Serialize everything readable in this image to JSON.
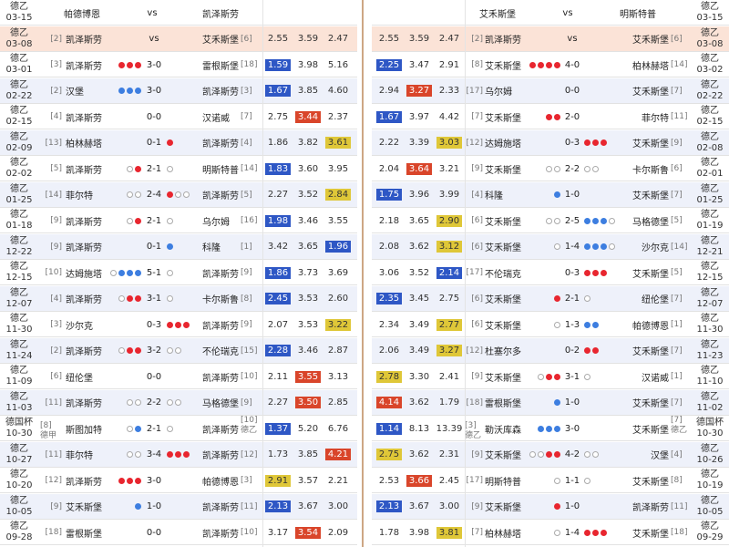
{
  "left": {
    "header": {
      "league": "德乙",
      "date": "03-15",
      "home": "帕德博恩",
      "vs": "vs",
      "away": "凯泽斯劳"
    },
    "current": {
      "league": "德乙",
      "date": "03-08",
      "home_rank": "[2]",
      "home": "凯泽斯劳",
      "vs": "vs",
      "away": "艾禾斯堡",
      "away_rank": "[6]",
      "o1": "2.55",
      "o2": "3.59",
      "o3": "2.47"
    },
    "rows": [
      {
        "league": "德乙",
        "date": "03-01",
        "home_rank": "[3]",
        "home": "凯泽斯劳",
        "dots_l": "rrr",
        "score": "3-0",
        "dots_r": "",
        "away": "雷根斯堡",
        "away_rank": "[18]",
        "o1": "1.59",
        "o2": "3.98",
        "o3": "5.16",
        "hl": "1b"
      },
      {
        "league": "德乙",
        "date": "02-22",
        "home_rank": "[2]",
        "home": "汉堡",
        "dots_l": "bbb",
        "score": "3-0",
        "dots_r": "",
        "away": "凯泽斯劳",
        "away_rank": "[3]",
        "o1": "1.67",
        "o2": "3.85",
        "o3": "4.60",
        "hl": "1b"
      },
      {
        "league": "德乙",
        "date": "02-15",
        "home_rank": "[4]",
        "home": "凯泽斯劳",
        "dots_l": "",
        "score": "0-0",
        "dots_r": "",
        "away": "汉诺威",
        "away_rank": "[7]",
        "o1": "2.75",
        "o2": "3.44",
        "o3": "2.37",
        "hl": "2r"
      },
      {
        "league": "德乙",
        "date": "02-09",
        "home_rank": "[13]",
        "home": "柏林赫塔",
        "dots_l": "",
        "score": "0-1",
        "dots_r": "r",
        "away": "凯泽斯劳",
        "away_rank": "[4]",
        "o1": "1.86",
        "o2": "3.82",
        "o3": "3.61",
        "hl": "3y"
      },
      {
        "league": "德乙",
        "date": "02-02",
        "home_rank": "[5]",
        "home": "凯泽斯劳",
        "dots_l": "or",
        "score": "2-1",
        "dots_r": "o",
        "away": "明斯特普",
        "away_rank": "[14]",
        "o1": "1.83",
        "o2": "3.60",
        "o3": "3.95",
        "hl": "1b"
      },
      {
        "league": "德乙",
        "date": "01-25",
        "home_rank": "[14]",
        "home": "菲尔特",
        "dots_l": "oo",
        "score": "2-4",
        "dots_r": "roo",
        "away": "凯泽斯劳",
        "away_rank": "[5]",
        "o1": "2.27",
        "o2": "3.52",
        "o3": "2.84",
        "hl": "3y"
      },
      {
        "league": "德乙",
        "date": "01-18",
        "home_rank": "[9]",
        "home": "凯泽斯劳",
        "dots_l": "or",
        "score": "2-1",
        "dots_r": "o",
        "away": "乌尔姆",
        "away_rank": "[16]",
        "o1": "1.98",
        "o2": "3.46",
        "o3": "3.55",
        "hl": "1b"
      },
      {
        "league": "德乙",
        "date": "12-22",
        "home_rank": "[9]",
        "home": "凯泽斯劳",
        "dots_l": "",
        "score": "0-1",
        "dots_r": "b",
        "away": "科隆",
        "away_rank": "[1]",
        "o1": "3.42",
        "o2": "3.65",
        "o3": "1.96",
        "hl": "3b"
      },
      {
        "league": "德乙",
        "date": "12-15",
        "home_rank": "[10]",
        "home": "达姆施塔",
        "dots_l": "obbb",
        "score": "5-1",
        "dots_r": "o",
        "away": "凯泽斯劳",
        "away_rank": "[9]",
        "o1": "1.86",
        "o2": "3.73",
        "o3": "3.69",
        "hl": "1b"
      },
      {
        "league": "德乙",
        "date": "12-07",
        "home_rank": "[4]",
        "home": "凯泽斯劳",
        "dots_l": "orr",
        "score": "3-1",
        "dots_r": "o",
        "away": "卡尔斯鲁",
        "away_rank": "[8]",
        "o1": "2.45",
        "o2": "3.53",
        "o3": "2.60",
        "hl": "1b"
      },
      {
        "league": "德乙",
        "date": "11-30",
        "home_rank": "[3]",
        "home": "沙尔克",
        "dots_l": "",
        "score": "0-3",
        "dots_r": "rrr",
        "away": "凯泽斯劳",
        "away_rank": "[9]",
        "o1": "2.07",
        "o2": "3.53",
        "o3": "3.22",
        "hl": "3y"
      },
      {
        "league": "德乙",
        "date": "11-24",
        "home_rank": "[2]",
        "home": "凯泽斯劳",
        "dots_l": "orr",
        "score": "3-2",
        "dots_r": "oo",
        "away": "不伦瑞克",
        "away_rank": "[15]",
        "o1": "2.28",
        "o2": "3.46",
        "o3": "2.87",
        "hl": "1b"
      },
      {
        "league": "德乙",
        "date": "11-09",
        "home_rank": "[6]",
        "home": "纽伦堡",
        "dots_l": "",
        "score": "0-0",
        "dots_r": "",
        "away": "凯泽斯劳",
        "away_rank": "[10]",
        "o1": "2.11",
        "o2": "3.55",
        "o3": "3.13",
        "hl": "2r"
      },
      {
        "league": "德乙",
        "date": "11-03",
        "home_rank": "[11]",
        "home": "凯泽斯劳",
        "dots_l": "oo",
        "score": "2-2",
        "dots_r": "oo",
        "away": "马格德堡",
        "away_rank": "[9]",
        "o1": "2.27",
        "o2": "3.50",
        "o3": "2.85",
        "hl": "2r"
      },
      {
        "league": "德国杯",
        "date": "10-30",
        "home_rank": "[8]",
        "home_rank2": "德甲",
        "home": "斯图加特",
        "dots_l": "ob",
        "score": "2-1",
        "dots_r": "o",
        "away": "凯泽斯劳",
        "away_rank": "[10]",
        "away_rank2": "德乙",
        "o1": "1.37",
        "o2": "5.20",
        "o3": "6.76",
        "hl": "1b"
      },
      {
        "league": "德乙",
        "date": "10-27",
        "home_rank": "[11]",
        "home": "菲尔特",
        "dots_l": "oo",
        "score": "3-4",
        "dots_r": "rrr",
        "away": "凯泽斯劳",
        "away_rank": "[12]",
        "o1": "1.73",
        "o2": "3.85",
        "o3": "4.21",
        "hl": "3r"
      },
      {
        "league": "德乙",
        "date": "10-20",
        "home_rank": "[12]",
        "home": "凯泽斯劳",
        "dots_l": "rrr",
        "score": "3-0",
        "dots_r": "",
        "away": "帕德博恩",
        "away_rank": "[3]",
        "o1": "2.91",
        "o2": "3.57",
        "o3": "2.21",
        "hl": "1y"
      },
      {
        "league": "德乙",
        "date": "10-05",
        "home_rank": "[9]",
        "home": "艾禾斯堡",
        "dots_l": "b",
        "score": "1-0",
        "dots_r": "",
        "away": "凯泽斯劳",
        "away_rank": "[11]",
        "o1": "2.13",
        "o2": "3.67",
        "o3": "3.00",
        "hl": "1b"
      },
      {
        "league": "德乙",
        "date": "09-28",
        "home_rank": "[18]",
        "home": "雷根斯堡",
        "dots_l": "",
        "score": "0-0",
        "dots_r": "",
        "away": "凯泽斯劳",
        "away_rank": "[10]",
        "o1": "3.17",
        "o2": "3.54",
        "o3": "2.09",
        "hl": "2r"
      }
    ]
  },
  "right": {
    "header": {
      "home": "艾禾斯堡",
      "vs": "vs",
      "away": "明斯特普",
      "league": "德乙",
      "date": "03-15"
    },
    "current": {
      "o1": "2.55",
      "o2": "3.59",
      "o3": "2.47",
      "home_rank": "[2]",
      "home": "凯泽斯劳",
      "vs": "vs",
      "away": "艾禾斯堡",
      "away_rank": "[6]",
      "league": "德乙",
      "date": "03-08"
    },
    "rows": [
      {
        "o1": "2.25",
        "o2": "3.47",
        "o3": "2.91",
        "hl": "1b",
        "home_rank": "[8]",
        "home": "艾禾斯堡",
        "dots_l": "rrrr",
        "score": "4-0",
        "dots_r": "",
        "away": "柏林赫塔",
        "away_rank": "[14]",
        "league": "德乙",
        "date": "03-02"
      },
      {
        "o1": "2.94",
        "o2": "3.27",
        "o3": "2.33",
        "hl": "2r",
        "home_rank": "[17]",
        "home": "乌尔姆",
        "dots_l": "",
        "score": "0-0",
        "dots_r": "",
        "away": "艾禾斯堡",
        "away_rank": "[7]",
        "league": "德乙",
        "date": "02-22"
      },
      {
        "o1": "1.67",
        "o2": "3.97",
        "o3": "4.42",
        "hl": "1b",
        "home_rank": "[7]",
        "home": "艾禾斯堡",
        "dots_l": "rr",
        "score": "2-0",
        "dots_r": "",
        "away": "菲尔特",
        "away_rank": "[11]",
        "league": "德乙",
        "date": "02-15"
      },
      {
        "o1": "2.22",
        "o2": "3.39",
        "o3": "3.03",
        "hl": "3y",
        "home_rank": "[12]",
        "home": "达姆施塔",
        "dots_l": "",
        "score": "0-3",
        "dots_r": "rrr",
        "away": "艾禾斯堡",
        "away_rank": "[9]",
        "league": "德乙",
        "date": "02-08"
      },
      {
        "o1": "2.04",
        "o2": "3.64",
        "o3": "3.21",
        "hl": "2r",
        "home_rank": "[9]",
        "home": "艾禾斯堡",
        "dots_l": "oo",
        "score": "2-2",
        "dots_r": "oo",
        "away": "卡尔斯鲁",
        "away_rank": "[6]",
        "league": "德乙",
        "date": "02-01"
      },
      {
        "o1": "1.75",
        "o2": "3.96",
        "o3": "3.99",
        "hl": "1b",
        "home_rank": "[4]",
        "home": "科隆",
        "dots_l": "b",
        "score": "1-0",
        "dots_r": "",
        "away": "艾禾斯堡",
        "away_rank": "[7]",
        "league": "德乙",
        "date": "01-25"
      },
      {
        "o1": "2.18",
        "o2": "3.65",
        "o3": "2.90",
        "hl": "3y",
        "home_rank": "[6]",
        "home": "艾禾斯堡",
        "dots_l": "oo",
        "score": "2-5",
        "dots_r": "bbbo",
        "away": "马格德堡",
        "away_rank": "[5]",
        "league": "德乙",
        "date": "01-19"
      },
      {
        "o1": "2.08",
        "o2": "3.62",
        "o3": "3.12",
        "hl": "3y",
        "home_rank": "[6]",
        "home": "艾禾斯堡",
        "dots_l": "o",
        "score": "1-4",
        "dots_r": "bbbo",
        "away": "沙尔克",
        "away_rank": "[14]",
        "league": "德乙",
        "date": "12-21"
      },
      {
        "o1": "3.06",
        "o2": "3.52",
        "o3": "2.14",
        "hl": "3b",
        "home_rank": "[17]",
        "home": "不伦瑞克",
        "dots_l": "",
        "score": "0-3",
        "dots_r": "rrr",
        "away": "艾禾斯堡",
        "away_rank": "[5]",
        "league": "德乙",
        "date": "12-15"
      },
      {
        "o1": "2.35",
        "o2": "3.45",
        "o3": "2.75",
        "hl": "1b",
        "home_rank": "[6]",
        "home": "艾禾斯堡",
        "dots_l": "r",
        "score": "2-1",
        "dots_r": "o",
        "away": "纽伦堡",
        "away_rank": "[7]",
        "league": "德乙",
        "date": "12-07"
      },
      {
        "o1": "2.34",
        "o2": "3.49",
        "o3": "2.77",
        "hl": "3y",
        "home_rank": "[6]",
        "home": "艾禾斯堡",
        "dots_l": "o",
        "score": "1-3",
        "dots_r": "bb",
        "away": "帕德博恩",
        "away_rank": "[1]",
        "league": "德乙",
        "date": "11-30"
      },
      {
        "o1": "2.06",
        "o2": "3.49",
        "o3": "3.27",
        "hl": "3y",
        "home_rank": "[12]",
        "home": "杜塞尔多",
        "dots_l": "",
        "score": "0-2",
        "dots_r": "rr",
        "away": "艾禾斯堡",
        "away_rank": "[7]",
        "league": "德乙",
        "date": "11-23"
      },
      {
        "o1": "2.78",
        "o2": "3.30",
        "o3": "2.41",
        "hl": "1y",
        "home_rank": "[9]",
        "home": "艾禾斯堡",
        "dots_l": "orr",
        "score": "3-1",
        "dots_r": "o",
        "away": "汉诺威",
        "away_rank": "[1]",
        "league": "德乙",
        "date": "11-10"
      },
      {
        "o1": "4.14",
        "o2": "3.62",
        "o3": "1.79",
        "hl": "1r",
        "home_rank": "[18]",
        "home": "雷根斯堡",
        "dots_l": "b",
        "score": "1-0",
        "dots_r": "",
        "away": "艾禾斯堡",
        "away_rank": "[7]",
        "league": "德乙",
        "date": "11-02"
      },
      {
        "o1": "1.14",
        "o2": "8.13",
        "o3": "13.39",
        "hl": "1b",
        "home_rank": "[3]",
        "home_rank2": "德乙",
        "home": "勒沃库森",
        "dots_l": "bbb",
        "score": "3-0",
        "dots_r": "",
        "away": "艾禾斯堡",
        "away_rank": "[7]",
        "away_rank2": "德乙",
        "league": "德国杯",
        "date": "10-30"
      },
      {
        "o1": "2.75",
        "o2": "3.62",
        "o3": "2.31",
        "hl": "1y",
        "home_rank": "[9]",
        "home": "艾禾斯堡",
        "dots_l": "oorr",
        "score": "4-2",
        "dots_r": "oo",
        "away": "汉堡",
        "away_rank": "[4]",
        "league": "德乙",
        "date": "10-26"
      },
      {
        "o1": "2.53",
        "o2": "3.66",
        "o3": "2.45",
        "hl": "2r",
        "home_rank": "[17]",
        "home": "明斯特普",
        "dots_l": "o",
        "score": "1-1",
        "dots_r": "o",
        "away": "艾禾斯堡",
        "away_rank": "[8]",
        "league": "德乙",
        "date": "10-19"
      },
      {
        "o1": "2.13",
        "o2": "3.67",
        "o3": "3.00",
        "hl": "1b",
        "home_rank": "[9]",
        "home": "艾禾斯堡",
        "dots_l": "r",
        "score": "1-0",
        "dots_r": "",
        "away": "凯泽斯劳",
        "away_rank": "[11]",
        "league": "德乙",
        "date": "10-05"
      },
      {
        "o1": "1.78",
        "o2": "3.98",
        "o3": "3.81",
        "hl": "3y",
        "home_rank": "[7]",
        "home": "柏林赫塔",
        "dots_l": "o",
        "score": "1-4",
        "dots_r": "rrr",
        "away": "艾禾斯堡",
        "away_rank": "[18]",
        "league": "德乙",
        "date": "09-29"
      }
    ]
  }
}
